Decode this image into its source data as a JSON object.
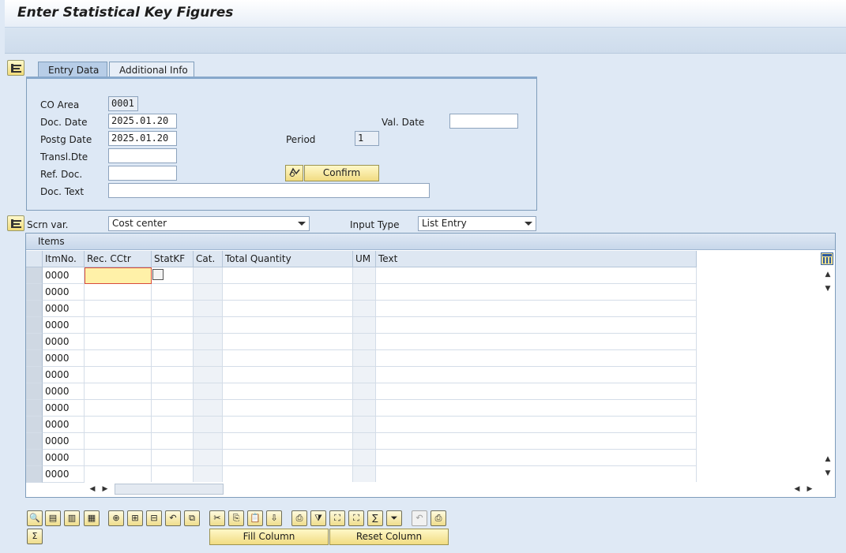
{
  "window": {
    "title": "Enter Statistical Key Figures"
  },
  "tabs": {
    "entry": "Entry Data",
    "additional": "Additional Info"
  },
  "header": {
    "co_area_label": "CO Area",
    "co_area": "0001",
    "doc_date_label": "Doc. Date",
    "doc_date": "2025.01.20",
    "postg_date_label": "Postg Date",
    "postg_date": "2025.01.20",
    "transl_label": "Transl.Dte",
    "transl": "",
    "ref_doc_label": "Ref. Doc.",
    "ref_doc": "",
    "doc_text_label": "Doc. Text",
    "doc_text": "",
    "val_date_label": "Val. Date",
    "val_date": "",
    "period_label": "Period",
    "period": "1",
    "confirm_label": "Confirm"
  },
  "screen": {
    "scrn_var_label": "Scrn var.",
    "scrn_var": "Cost center",
    "input_type_label": "Input Type",
    "input_type": "List Entry"
  },
  "items": {
    "title": "Items",
    "columns": [
      "ItmNo.",
      "Rec. CCtr",
      "StatKF",
      "Cat.",
      "Total Quantity",
      "UM",
      "Text"
    ],
    "rows": [
      "0000",
      "0000",
      "0000",
      "0000",
      "0000",
      "0000",
      "0000",
      "0000",
      "0000",
      "0000",
      "0000",
      "0000",
      "0000"
    ]
  },
  "bottom": {
    "fill_column": "Fill Column",
    "reset_column": "Reset Column"
  },
  "icons": {
    "toolbar": [
      "details-icon",
      "select-all-icon",
      "select-block-icon",
      "deselect-all-icon",
      "insert-row-icon",
      "append-row-icon",
      "delete-row-icon",
      "undo-icon",
      "copy-row-icon",
      "cut-icon",
      "copy-icon",
      "paste-icon",
      "paste-append-icon",
      "sort-icon",
      "filter-sort-icon",
      "find-icon",
      "find-next-icon",
      "subtotal-icon",
      "filter-icon",
      "undo-disabled-icon",
      "print-icon",
      "sum-icon"
    ]
  },
  "colors": {
    "accent": "#f1dc82",
    "panel": "#dde8f5",
    "highlight": "#fff1a8"
  }
}
